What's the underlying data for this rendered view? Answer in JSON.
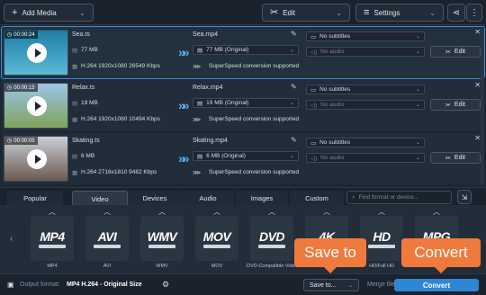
{
  "toolbar": {
    "add_media": "Add Media",
    "edit": "Edit",
    "settings": "Settings"
  },
  "files": [
    {
      "time": "00:00:24",
      "name": "Sea.ts",
      "size": "77 MB",
      "info": "H.264 1920x1080 26549 Kbps",
      "out_name": "Sea.mp4",
      "out_size": "77 MB (Original)",
      "subtitles": "No subtitles",
      "audio": "No audio",
      "superspeed": "SuperSpeed conversion supported",
      "edit": "Edit",
      "selected": true,
      "thumb_colors": [
        "#1e7fa6",
        "#5bb8d6"
      ]
    },
    {
      "time": "00:00:15",
      "name": "Relax.ts",
      "size": "19 MB",
      "info": "H.264 1920x1080 10494 Kbps",
      "out_name": "Relax.mp4",
      "out_size": "19 MB (Original)",
      "subtitles": "No subtitles",
      "audio": "No audio",
      "superspeed": "SuperSpeed conversion supported",
      "edit": "Edit",
      "selected": false,
      "thumb_colors": [
        "#9dc5e8",
        "#7fa35a"
      ]
    },
    {
      "time": "00:00:05",
      "name": "Skating.ts",
      "size": "6 MB",
      "info": "H.264 2716x1810 9482 Kbps",
      "out_name": "Skating.mp4",
      "out_size": "6 MB (Original)",
      "subtitles": "No subtitles",
      "audio": "No audio",
      "superspeed": "SuperSpeed conversion supported",
      "edit": "Edit",
      "selected": false,
      "thumb_colors": [
        "#c9cfd6",
        "#6c5a4f"
      ]
    }
  ],
  "tabs": [
    "Popular",
    "Video",
    "Devices",
    "Audio",
    "Images",
    "Custom"
  ],
  "active_tab": "Video",
  "search": {
    "placeholder": "Find format or device..."
  },
  "formats": [
    {
      "logo": "MP4",
      "name": "MP4"
    },
    {
      "logo": "AVI",
      "name": "AVI"
    },
    {
      "logo": "WMV",
      "name": "WMV"
    },
    {
      "logo": "MOV",
      "name": "MOV"
    },
    {
      "logo": "DVD",
      "name": "DVD-Compatible Video"
    },
    {
      "logo": "4K",
      "name": ""
    },
    {
      "logo": "HD",
      "name": "HD/Full HD"
    },
    {
      "logo": "MPG",
      "name": ""
    }
  ],
  "bottom": {
    "output_label": "Output format:",
    "output_value": "MP4 H.264 - Original Size",
    "save_to": "Save to...",
    "merge": "Merge files:",
    "convert": "Convert"
  },
  "callouts": {
    "save": "Save to",
    "convert": "Convert"
  },
  "colors": {
    "accent": "#2f86d6",
    "callout": "#f07a3e"
  }
}
